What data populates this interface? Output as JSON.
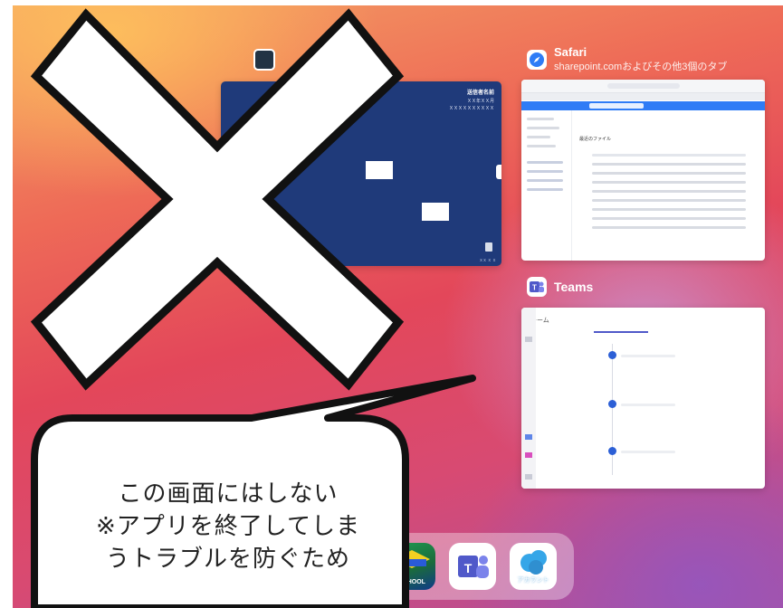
{
  "app_switcher": {
    "left_card": {
      "sender_name": "送信者名前",
      "caption_line1": "ＸＸ年ＸＸ月",
      "caption_line2": "ＸＸＸＸＸＸＸＸＸＸ",
      "footer": "ＸＸ Ｘ Ｘ"
    },
    "safari": {
      "title": "Safari",
      "subtitle": "sharepoint.comおよびその他3個のタブ",
      "page_heading": "最近のファイル"
    },
    "teams": {
      "title": "Teams",
      "nav_label": "チーム"
    }
  },
  "callout": {
    "text": "この画面にはしない\n※アプリを終了してしま\nうトラブルを防ぐため"
  },
  "dock": {
    "apps": [
      "school-app",
      "teams-app",
      "account-app"
    ],
    "school_label": "SCHOOL",
    "account_label": "アカウント"
  },
  "colors": {
    "left_card_bg": "#1f3a7a",
    "teams_purple": "#5059c9",
    "safari_blue": "#2f7cf6",
    "account_blue": "#35a6e8",
    "x_mark_fill": "#ffffff",
    "x_mark_outline": "#111111"
  }
}
